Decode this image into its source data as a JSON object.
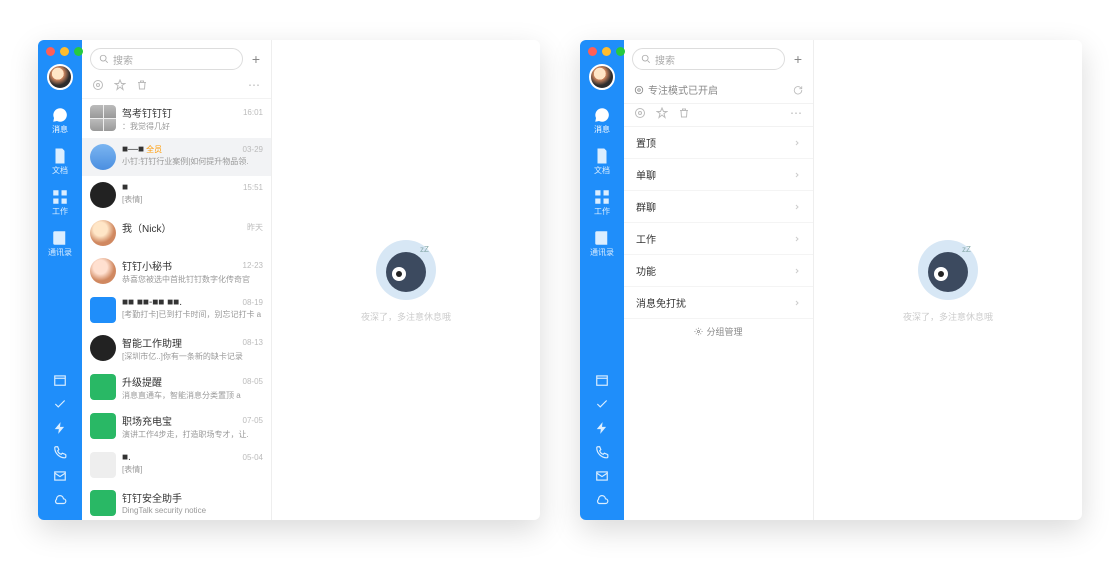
{
  "search_placeholder": "搜索",
  "nav": {
    "items": [
      "消息",
      "文档",
      "工作",
      "通讯录"
    ]
  },
  "empty_text": "夜深了，多注意休息哦",
  "focus_mode_label": "专注模式已开启",
  "group_mgmt": "分组管理",
  "groups": [
    "置顶",
    "单聊",
    "群聊",
    "工作",
    "功能",
    "消息免打扰"
  ],
  "conversations": [
    {
      "title": "驾考钉钉钉",
      "time": "16:01",
      "sub": "：我觉得几好",
      "avtype": "multi",
      "avcolor": ""
    },
    {
      "title": "■—■",
      "badge": "全员",
      "time": "03-29",
      "sub": "小钉:钉钉行业案例|如何提升物品领.",
      "avtype": "round",
      "avcolor": "linear-gradient(#7bb5f1,#4b8fe0)",
      "sel": true
    },
    {
      "title": "■",
      "time": "15:51",
      "sub": "[表情]",
      "avtype": "round",
      "avcolor": "#222"
    },
    {
      "title": "我（Nick）",
      "time": "昨天",
      "sub": "",
      "avtype": "round",
      "avcolor": "radial-gradient(circle at 40% 35%,#ffe6c7 30%,#d08860 60%)"
    },
    {
      "title": "钉钉小秘书",
      "time": "12-23",
      "sub": "恭喜您被选中首批钉钉数字化传奇官",
      "avtype": "round",
      "avcolor": "radial-gradient(circle at 40% 35%,#ffe0d0 30%,#d08860 60%)"
    },
    {
      "title": "■■ ■■-■■ ■■.",
      "time": "08-19",
      "sub": "[考勤打卡]已到打卡时间，别忘记打卡  a",
      "avtype": "sq",
      "avcolor": "#1f8efa"
    },
    {
      "title": "智能工作助理",
      "time": "08-13",
      "sub": "[深圳市亿..]你有一条新的缺卡记录",
      "avtype": "round",
      "avcolor": "#222"
    },
    {
      "title": "升级提醒",
      "time": "08-05",
      "sub": "消息直通车，智能消息分类置顶   a",
      "avtype": "sq",
      "avcolor": "#29b865"
    },
    {
      "title": "职场充电宝",
      "time": "07-05",
      "sub": "演讲工作4步走，打造职场专才，让.",
      "avtype": "sq",
      "avcolor": "#29b865"
    },
    {
      "title": "■.",
      "time": "05-04",
      "sub": "[表情]",
      "avtype": "sq",
      "avcolor": "#eee"
    },
    {
      "title": "钉钉安全助手",
      "time": "",
      "sub": "DingTalk security notice",
      "avtype": "sq",
      "avcolor": "#29b865"
    }
  ]
}
